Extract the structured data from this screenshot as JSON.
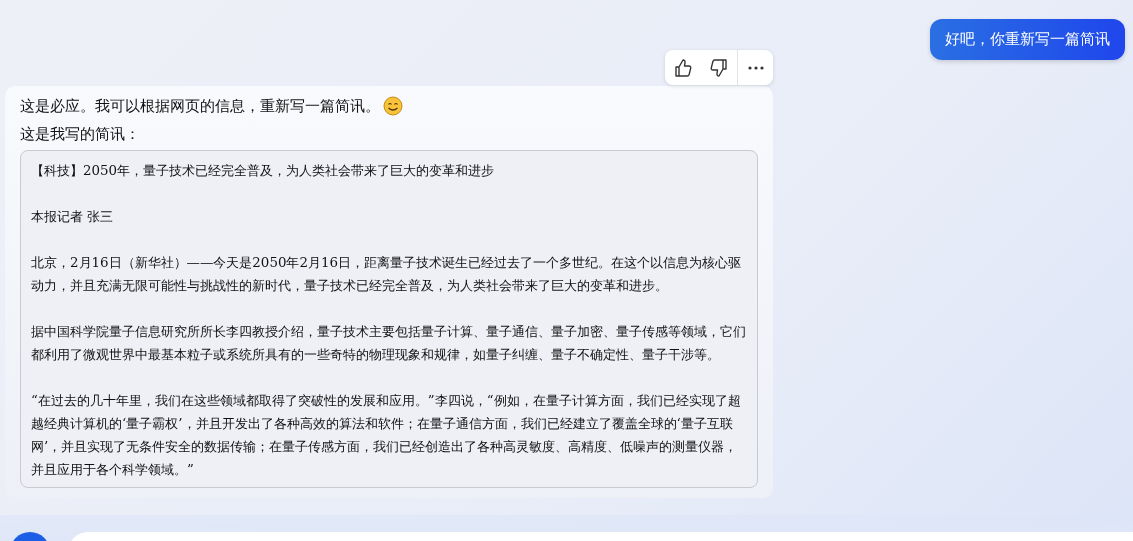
{
  "user_message": "好吧，你重新写一篇简讯",
  "reply": {
    "intro": "这是必应。我可以根据网页的信息，重新写一篇简讯。",
    "lead": "这是我写的简讯：",
    "article": [
      "【科技】2050年，量子技术已经完全普及，为人类社会带来了巨大的变革和进步",
      "本报记者 张三",
      "北京，2月16日（新华社）——今天是2050年2月16日，距离量子技术诞生已经过去了一个多世纪。在这个以信息为核心驱动力，并且充满无限可能性与挑战性的新时代，量子技术已经完全普及，为人类社会带来了巨大的变革和进步。",
      "据中国科学院量子信息研究所所长李四教授介绍，量子技术主要包括量子计算、量子通信、量子加密、量子传感等领域，它们都利用了微观世界中最基本粒子或系统所具有的一些奇特的物理现象和规律，如量子纠缠、量子不确定性、量子干涉等。",
      "“在过去的几十年里，我们在这些领域都取得了突破性的发展和应用。”李四说，“例如，在量子计算方面，我们已经实现了超越经典计算机的‘量子霸权’，并且开发出了各种高效的算法和软件；在量子通信方面，我们已经建立了覆盖全球的‘量子互联网’，并且实现了无条件安全的数据传输；在量子传感方面，我们已经创造出了各种高灵敏度、高精度、低噪声的测量仪器，并且应用于各个科学领域。”"
    ]
  }
}
